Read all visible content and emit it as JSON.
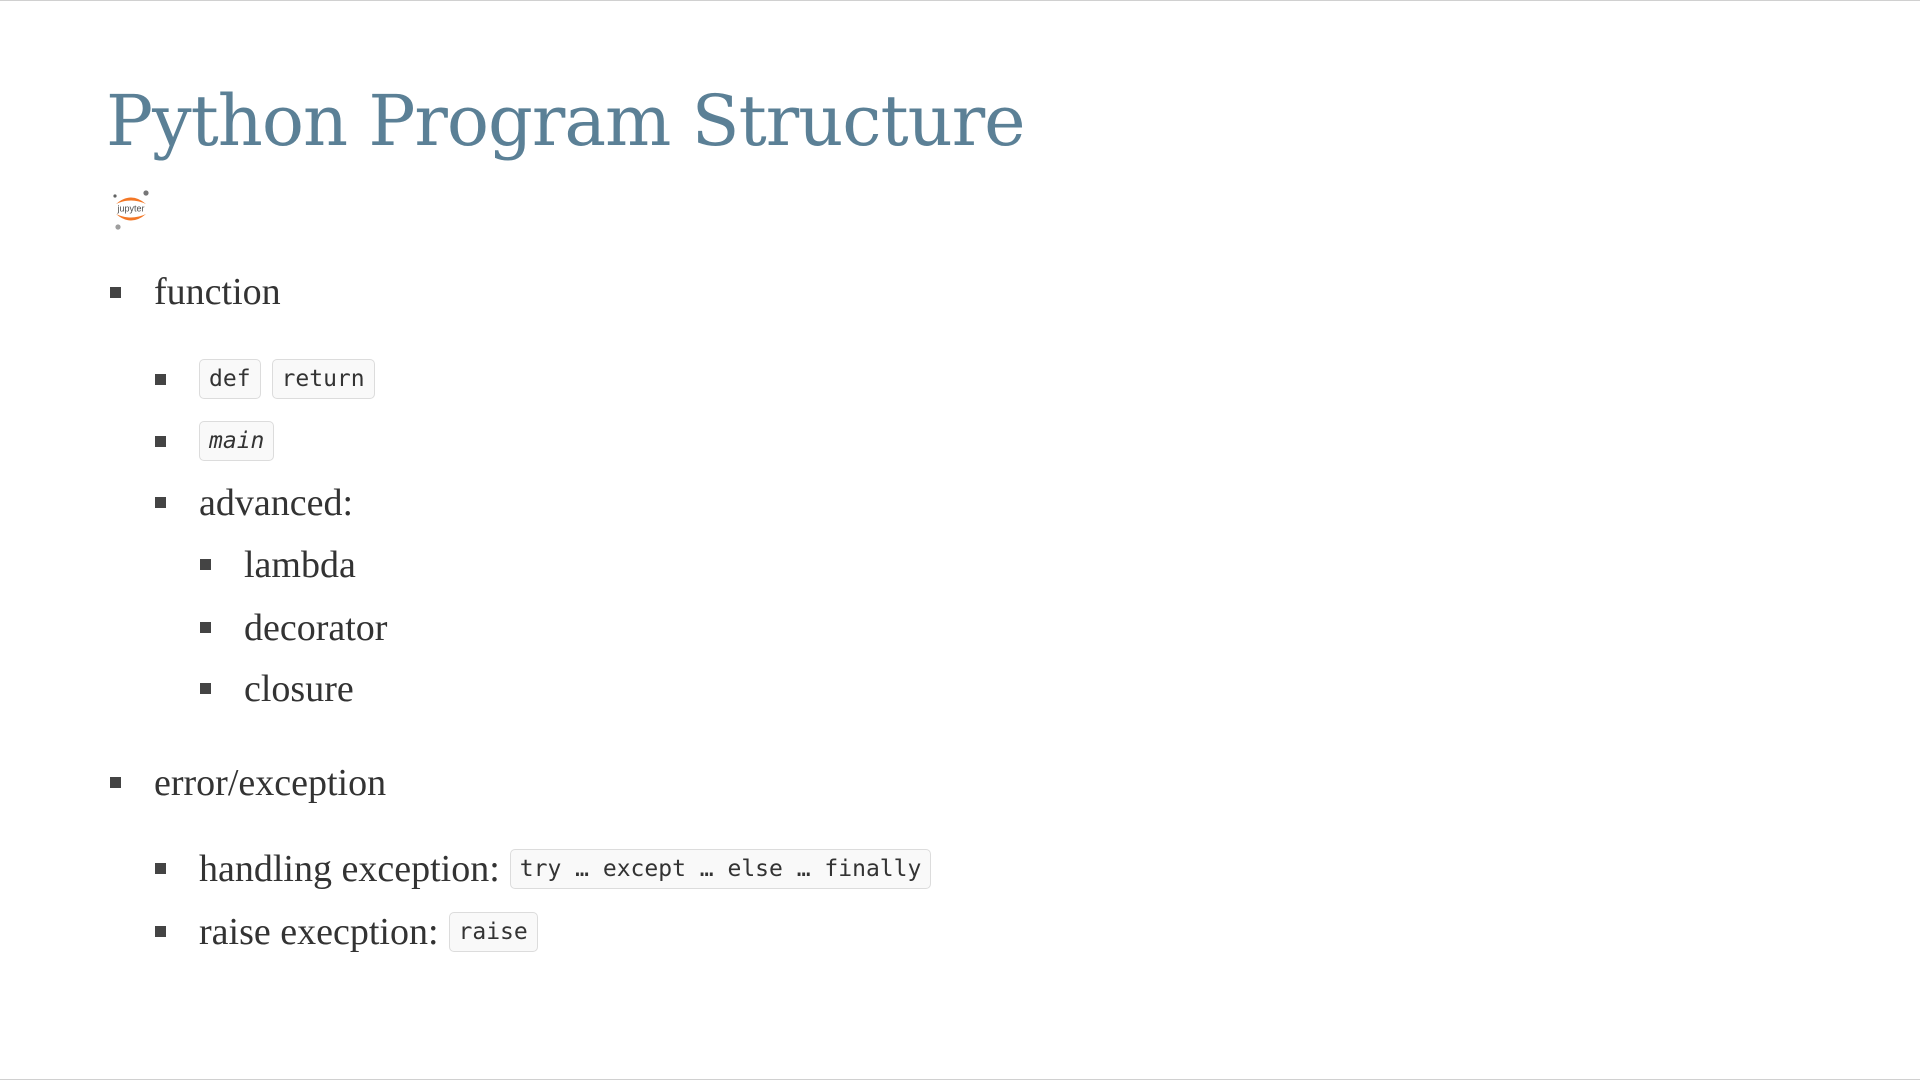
{
  "slide": {
    "title": "Python Program Structure",
    "logo": {
      "icon": "jupyter-logo-icon",
      "text": "jupyter",
      "accent_color": "#f37726"
    },
    "bullets": [
      {
        "text": "function"
      },
      {
        "codes": [
          "def",
          "return"
        ]
      },
      {
        "codes": [
          "main"
        ]
      },
      {
        "text": "advanced:"
      },
      {
        "text": "lambda"
      },
      {
        "text": "decorator"
      },
      {
        "text": "closure"
      },
      {
        "text": "error/exception"
      },
      {
        "text": "handling exception:",
        "codes": [
          "try … except … else … finally"
        ]
      },
      {
        "text": "raise execption:",
        "codes": [
          "raise"
        ]
      }
    ]
  },
  "colors": {
    "title": "#5b8096",
    "text": "#333333",
    "bullet": "#444444",
    "code_background": "#f9f9f9",
    "code_border": "#dcdcdc"
  }
}
